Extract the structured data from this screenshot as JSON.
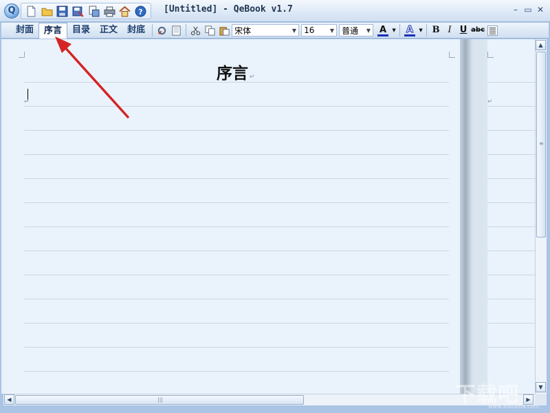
{
  "window": {
    "title": "[Untitled] - QeBook v1.7",
    "orb_glyph": "Q",
    "minimize_glyph": "–",
    "maximize_glyph": "▭",
    "close_glyph": "✕"
  },
  "quick_access": [
    "new-file-icon",
    "open-folder-icon",
    "save-icon",
    "save-as-icon",
    "export-icon",
    "print-icon",
    "home-icon",
    "help-icon"
  ],
  "tabs": [
    {
      "label": "封面",
      "active": false
    },
    {
      "label": "序言",
      "active": true
    },
    {
      "label": "目录",
      "active": false
    },
    {
      "label": "正文",
      "active": false
    },
    {
      "label": "封底",
      "active": false
    }
  ],
  "toolbar": {
    "font_name": "宋体",
    "font_size": "16",
    "style": "普通",
    "font_color_glyph": "A",
    "highlight_glyph": "A",
    "bold": "B",
    "italic": "I",
    "underline": "U",
    "strikethrough": "abc",
    "font_color": "#1a2fb5",
    "highlight_color": "#1a2fb5"
  },
  "document": {
    "heading": "序言",
    "para_mark": "↵"
  },
  "watermark": {
    "text": "下载吧",
    "site": "www.xiazaiba.com"
  },
  "colors": {
    "annotation_arrow": "#d42424"
  }
}
